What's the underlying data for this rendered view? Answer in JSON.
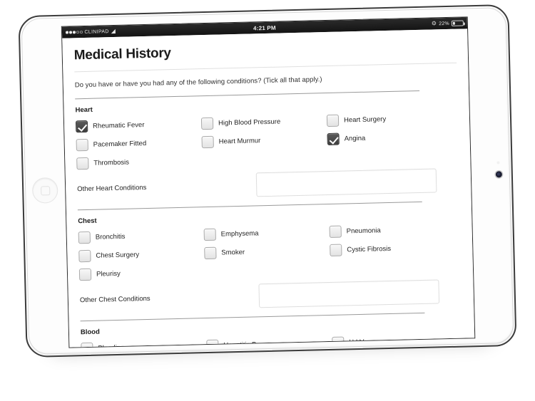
{
  "status_bar": {
    "signal_filled": 3,
    "signal_empty": 2,
    "carrier": "CLINIPAD",
    "wifi_icon": "wifi-icon",
    "time": "4:21 PM",
    "bluetooth_icon": "bluetooth-icon",
    "battery_percent": "22%",
    "battery_level": 22
  },
  "page": {
    "title": "Medical History",
    "intro": "Do you have or have you had any of the following conditions? (Tick all that apply.)"
  },
  "sections": [
    {
      "title": "Heart",
      "items": [
        {
          "label": "Rheumatic Fever",
          "checked": true
        },
        {
          "label": "High Blood Pressure",
          "checked": false
        },
        {
          "label": "Heart Surgery",
          "checked": false
        },
        {
          "label": "Pacemaker Fitted",
          "checked": false
        },
        {
          "label": "Heart Murmur",
          "checked": false
        },
        {
          "label": "Angina",
          "checked": true
        },
        {
          "label": "Thrombosis",
          "checked": false
        }
      ],
      "other": {
        "label": "Other Heart Conditions",
        "value": "",
        "placeholder": ""
      }
    },
    {
      "title": "Chest",
      "items": [
        {
          "label": "Bronchitis",
          "checked": false
        },
        {
          "label": "Emphysema",
          "checked": false
        },
        {
          "label": "Pneumonia",
          "checked": false
        },
        {
          "label": "Chest Surgery",
          "checked": false
        },
        {
          "label": "Smoker",
          "checked": false
        },
        {
          "label": "Cystic Fibrosis",
          "checked": false
        },
        {
          "label": "Pleurisy",
          "checked": false
        }
      ],
      "other": {
        "label": "Other Chest Conditions",
        "value": "",
        "placeholder": ""
      }
    },
    {
      "title": "Blood",
      "items": [
        {
          "label": "Bleeding",
          "checked": false
        },
        {
          "label": "Hepatitis B",
          "checked": false
        },
        {
          "label": "H.I.V",
          "checked": false
        }
      ],
      "other": null
    }
  ],
  "device": {
    "home_button": "home-button",
    "camera": "front-camera",
    "sensor": "ambient-light-sensor"
  },
  "colors": {
    "checkbox_checked": "#454545",
    "checkbox_unchecked": "#eeeeee",
    "status_bar": "#1c1c1c",
    "text": "#1f1f1f",
    "divider": "#9a9a9a"
  }
}
